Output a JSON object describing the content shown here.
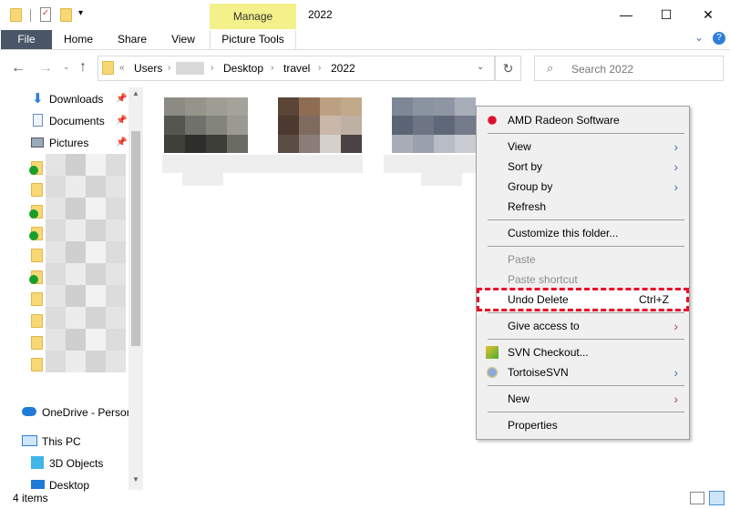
{
  "window": {
    "title": "2022",
    "minimize": "—",
    "maximize": "☐",
    "close": "✕"
  },
  "ribbon": {
    "context_tab": "Manage",
    "tabs": [
      "File",
      "Home",
      "Share",
      "View",
      "Picture Tools"
    ],
    "help": "?",
    "expand": "⌄"
  },
  "address": {
    "breadcrumb": [
      "Users",
      "Desktop",
      "travel",
      "2022"
    ],
    "overflow": "«",
    "refresh": "↻",
    "search_placeholder": "Search 2022"
  },
  "nav": {
    "quick_access": [
      {
        "label": "Downloads",
        "icon": "download-icon"
      },
      {
        "label": "Documents",
        "icon": "documents-icon"
      },
      {
        "label": "Pictures",
        "icon": "pictures-icon"
      }
    ],
    "onedrive": "OneDrive - Person",
    "this_pc": "This PC",
    "pc_items": [
      "3D Objects",
      "Desktop"
    ]
  },
  "status": {
    "items_count": "4 items"
  },
  "context_menu": {
    "items": [
      {
        "label": "AMD Radeon Software",
        "icon": "amd-radeon-icon"
      },
      {
        "sep": true
      },
      {
        "label": "View",
        "submenu": true
      },
      {
        "label": "Sort by",
        "submenu": true
      },
      {
        "label": "Group by",
        "submenu": true
      },
      {
        "label": "Refresh"
      },
      {
        "sep": true
      },
      {
        "label": "Customize this folder..."
      },
      {
        "sep": true
      },
      {
        "label": "Paste",
        "disabled": true
      },
      {
        "label": "Paste shortcut",
        "disabled": true
      },
      {
        "label": "Undo Delete",
        "shortcut": "Ctrl+Z",
        "highlighted": true
      },
      {
        "sep": true
      },
      {
        "label": "Give access to",
        "submenu": true
      },
      {
        "sep": true
      },
      {
        "label": "SVN Checkout...",
        "icon": "svn-checkout-icon"
      },
      {
        "label": "TortoiseSVN",
        "icon": "tortoisesvn-icon",
        "submenu": true
      },
      {
        "sep": true
      },
      {
        "label": "New",
        "submenu": true
      },
      {
        "sep": true
      },
      {
        "label": "Properties"
      }
    ]
  },
  "colors": {
    "highlight_border": "#e8102a",
    "manage_tab": "#f4f08a",
    "file_tab": "#485668"
  }
}
